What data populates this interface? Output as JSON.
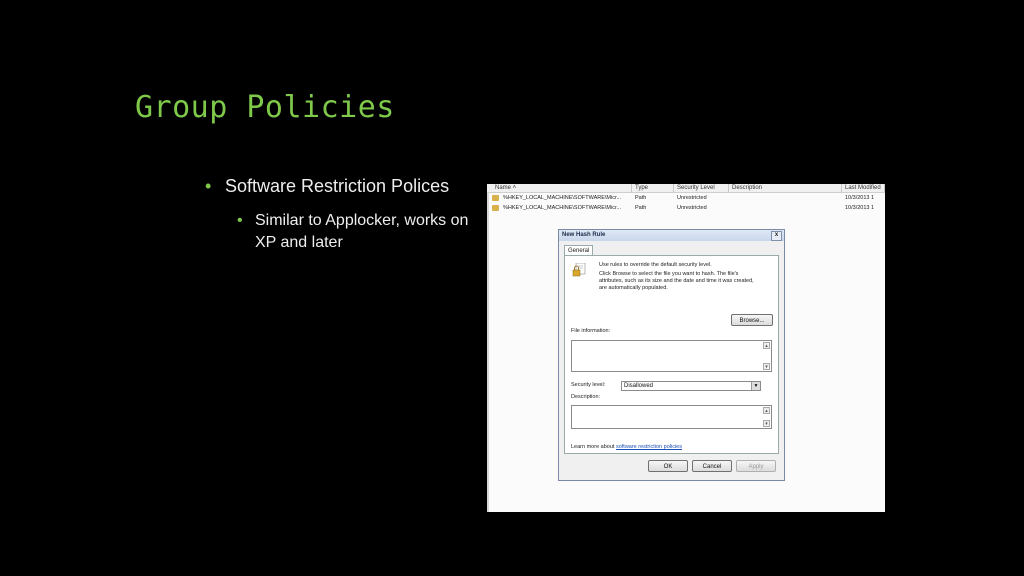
{
  "slide": {
    "title": "Group Policies",
    "bullets": [
      {
        "text": "Software Restriction Polices"
      },
      {
        "text": "Similar to Applocker, works on XP and later"
      }
    ]
  },
  "list_view": {
    "columns": [
      "Name",
      "Type",
      "Security Level",
      "Description",
      "Last Modified"
    ],
    "rows": [
      {
        "name": "%HKEY_LOCAL_MACHINE\\SOFTWARE\\Micr...",
        "type": "Path",
        "security_level": "Unrestricted",
        "description": "",
        "last_modified": "10/3/2013 1"
      },
      {
        "name": "%HKEY_LOCAL_MACHINE\\SOFTWARE\\Micr...",
        "type": "Path",
        "security_level": "Unrestricted",
        "description": "",
        "last_modified": "10/3/2013 1"
      }
    ]
  },
  "dialog": {
    "title": "New Hash Rule",
    "close": "x",
    "tab": "General",
    "intro_line1": "Use rules to override the default security level.",
    "intro_line2": "Click Browse to select the file you want to hash. The file's",
    "intro_line3": "attributes, such as its size and the date and time it was created,",
    "intro_line4": "are automatically populated.",
    "browse_button": "Browse...",
    "file_info_label": "File information:",
    "security_level_label": "Security level:",
    "security_level_value": "Disallowed",
    "description_label": "Description:",
    "learn_more_prefix": "Learn more about",
    "learn_more_link": "software restriction policies",
    "ok_button": "OK",
    "cancel_button": "Cancel",
    "apply_button": "Apply"
  },
  "colors": {
    "title": "#7ec84a",
    "bullet_dot": "#7ec84a",
    "background": "#000000"
  }
}
